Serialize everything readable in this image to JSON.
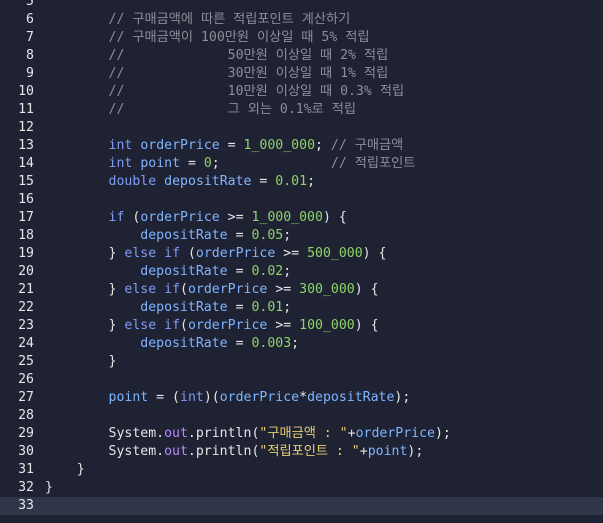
{
  "editor": {
    "lines": [
      {
        "num": "5",
        "text": ""
      },
      {
        "num": "6",
        "text": "        // 구매금액에 따른 적립포인트 계산하기"
      },
      {
        "num": "7",
        "text": "        // 구매금액이 100만원 이상일 때 5% 적립"
      },
      {
        "num": "8",
        "text": "        //             50만원 이상일 때 2% 적립"
      },
      {
        "num": "9",
        "text": "        //             30만원 이상일 때 1% 적립"
      },
      {
        "num": "10",
        "text": "        //             10만원 이상일 때 0.3% 적립"
      },
      {
        "num": "11",
        "text": "        //             그 외는 0.1%로 적립"
      },
      {
        "num": "12",
        "text": ""
      },
      {
        "num": "13",
        "text": "        int orderPrice = 1_000_000; // 구매금액"
      },
      {
        "num": "14",
        "text": "        int point = 0;              // 적립포인트"
      },
      {
        "num": "15",
        "text": "        double depositRate = 0.01;"
      },
      {
        "num": "16",
        "text": ""
      },
      {
        "num": "17",
        "text": "        if (orderPrice >= 1_000_000) {"
      },
      {
        "num": "18",
        "text": "            depositRate = 0.05;"
      },
      {
        "num": "19",
        "text": "        } else if (orderPrice >= 500_000) {"
      },
      {
        "num": "20",
        "text": "            depositRate = 0.02;"
      },
      {
        "num": "21",
        "text": "        } else if(orderPrice >= 300_000) {"
      },
      {
        "num": "22",
        "text": "            depositRate = 0.01;"
      },
      {
        "num": "23",
        "text": "        } else if(orderPrice >= 100_000) {"
      },
      {
        "num": "24",
        "text": "            depositRate = 0.003;"
      },
      {
        "num": "25",
        "text": "        }"
      },
      {
        "num": "26",
        "text": ""
      },
      {
        "num": "27",
        "text": "        point = (int)(orderPrice*depositRate);"
      },
      {
        "num": "28",
        "text": ""
      },
      {
        "num": "29",
        "text": "        System.out.println(\"구매금액 : \"+orderPrice);"
      },
      {
        "num": "30",
        "text": "        System.out.println(\"적립포인트 : \"+point);"
      },
      {
        "num": "31",
        "text": "    }"
      },
      {
        "num": "32",
        "text": "}"
      },
      {
        "num": "33",
        "text": ""
      }
    ],
    "current_line": "33",
    "colors": {
      "background": "#1e2233",
      "current_line": "#30364a",
      "comment": "#8c8f99",
      "keyword": "#7f9cf5",
      "number": "#8fd36a",
      "identifier": "#7fb4ff",
      "string": "#e6cf73",
      "field": "#b889f7",
      "default": "#e6e6e6"
    }
  }
}
